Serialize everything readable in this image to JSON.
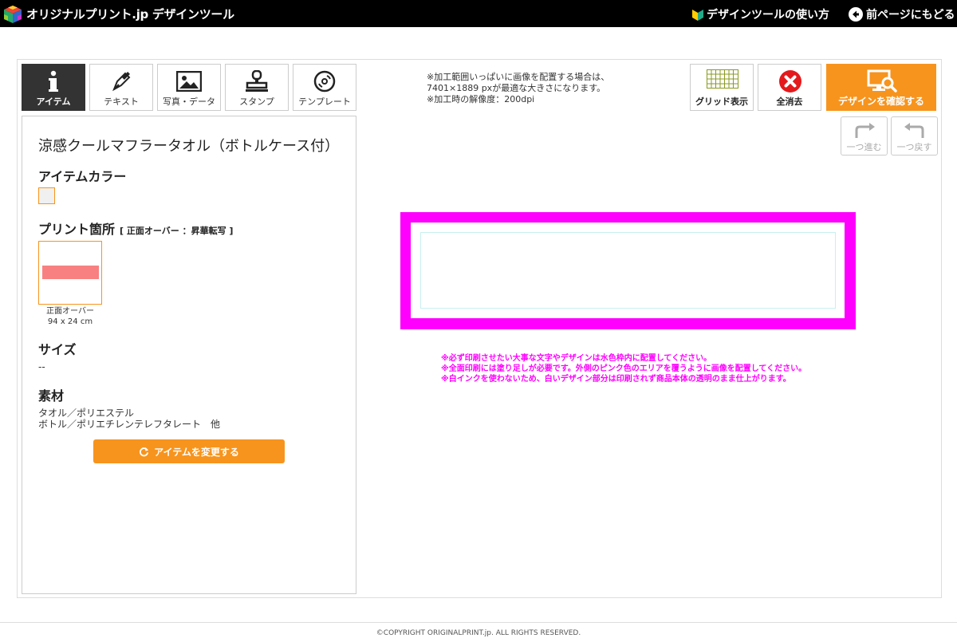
{
  "header": {
    "brand": "オリジナルプリント.jp デザインツール",
    "howto_label": "デザインツールの使い方",
    "back_label": "前ページにもどる"
  },
  "tabs": [
    {
      "label": "アイテム",
      "icon": "info-icon",
      "active": true
    },
    {
      "label": "テキスト",
      "icon": "pen-icon",
      "active": false
    },
    {
      "label": "写真・データ",
      "icon": "image-icon",
      "active": false
    },
    {
      "label": "スタンプ",
      "icon": "stamp-icon",
      "active": false
    },
    {
      "label": "テンプレート",
      "icon": "disc-icon",
      "active": false
    }
  ],
  "notice": "※加工範囲いっぱいに画像を配置する場合は、\n7401×1889 pxが最適な大きさになります。\n※加工時の解像度：200dpi",
  "tools": {
    "grid_label": "グリッド表示",
    "clear_label": "全消去",
    "confirm_label": "デザインを確認する",
    "redo_label": "一つ進む",
    "undo_label": "一つ戻す"
  },
  "panel": {
    "item_title": "涼感クールマフラータオル（ボトルケース付）",
    "color_heading": "アイテムカラー",
    "print_heading": "プリント箇所",
    "print_sub": "[ 正面オーバー ：昇華転写 ]",
    "print_area_name": "正面オーバー",
    "print_area_size": "94 x 24 cm",
    "size_heading": "サイズ",
    "size_value": "--",
    "material_heading": "素材",
    "material_text": "タオル／ポリエステル\nボトル／ポリエチレンテレフタレート　他",
    "change_label": "アイテムを変更する"
  },
  "warnings": "※必ず印刷させたい大事な文字やデザインは水色枠内に配置してください。\n※全面印刷には塗り足しが必要です。外側のピンク色のエリアを覆うように画像を配置してください。\n※白インクを使わないため、白いデザイン部分は印刷されず商品本体の透明のまま仕上がります。",
  "footer": "©COPYRIGHT ORIGINALPRINT.jp. ALL RIGHTS RESERVED.",
  "colors": {
    "accent": "#f7941d",
    "bleed": "#ff00ff",
    "active_tab": "#333333",
    "print_area_fill": "#f88080"
  }
}
